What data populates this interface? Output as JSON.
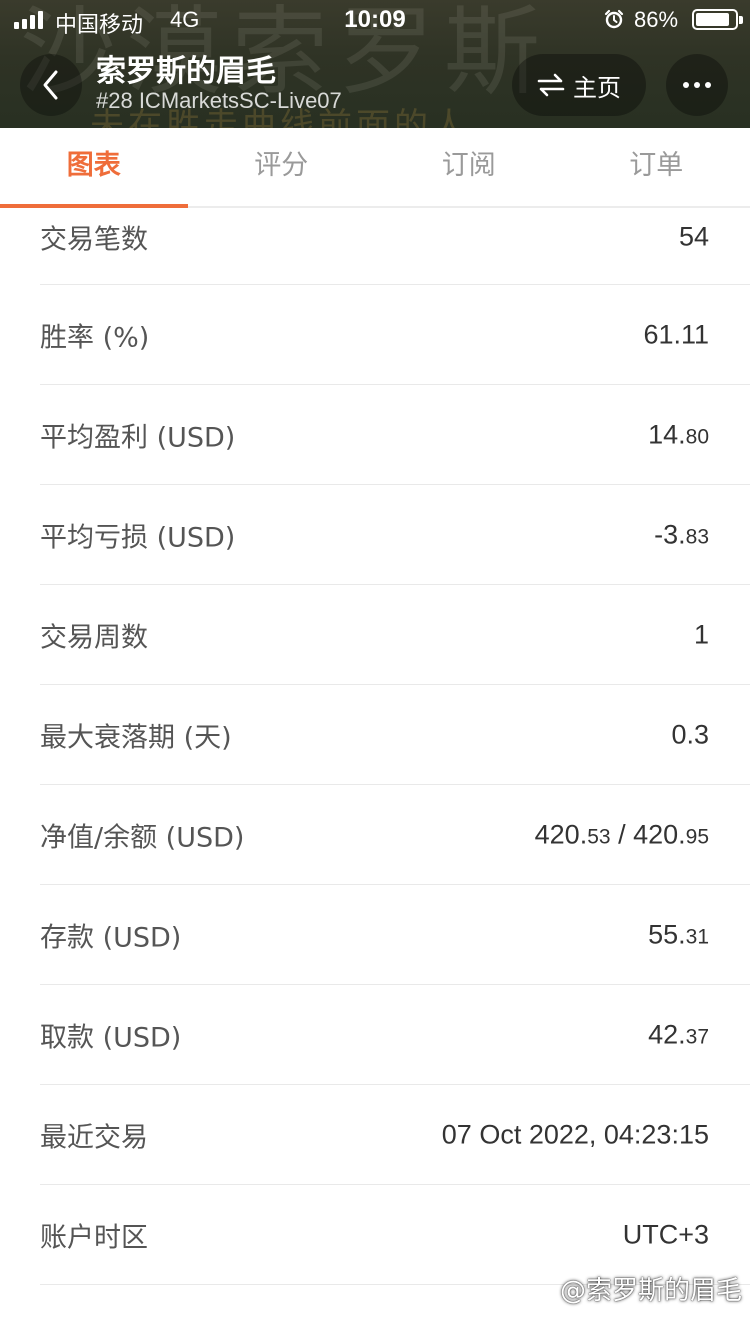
{
  "status_bar": {
    "carrier": "中国移动",
    "network": "4G",
    "time": "10:09",
    "battery_percent": "86%",
    "battery_level": 0.86
  },
  "header": {
    "background_text": "沙漠索罗斯",
    "background_text_small": "未在胜走曲线前面的人",
    "title": "索罗斯的眉毛",
    "subtitle": "#28 ICMarketsSC-Live07",
    "home_label": "主页",
    "icons": {
      "back": "chevron-left-icon",
      "home": "swap-arrows-icon",
      "more": "more-dots-icon"
    }
  },
  "tabs": [
    {
      "label": "图表",
      "active": true
    },
    {
      "label": "评分",
      "active": false
    },
    {
      "label": "订阅",
      "active": false
    },
    {
      "label": "订单",
      "active": false
    }
  ],
  "stats": [
    {
      "label": "交易笔数",
      "value": "54"
    },
    {
      "label": "胜率 (%)",
      "value": "61.11"
    },
    {
      "label": "平均盈利 (USD)",
      "value_int": "14.",
      "value_dec": "80"
    },
    {
      "label": "平均亏损 (USD)",
      "value_int": "-3.",
      "value_dec": "83"
    },
    {
      "label": "交易周数",
      "value": "1"
    },
    {
      "label": "最大衰落期 (天)",
      "value": "0.3"
    },
    {
      "label": "净值/余额 (USD)",
      "equity_int": "420.",
      "equity_dec": "53",
      "separator": " / ",
      "balance_int": "420.",
      "balance_dec": "95"
    },
    {
      "label": "存款 (USD)",
      "value_int": "55.",
      "value_dec": "31"
    },
    {
      "label": "取款 (USD)",
      "value_int": "42.",
      "value_dec": "37"
    },
    {
      "label": "最近交易",
      "value": "07 Oct 2022, 04:23:15"
    },
    {
      "label": "账户时区",
      "value": "UTC+3"
    }
  ],
  "watermark": "@索罗斯的眉毛",
  "colors": {
    "accent": "#ef6d3a",
    "header_bg": "#2f3325",
    "text_primary": "#333333",
    "text_label": "#555555",
    "tab_inactive": "#9a9a9a"
  }
}
